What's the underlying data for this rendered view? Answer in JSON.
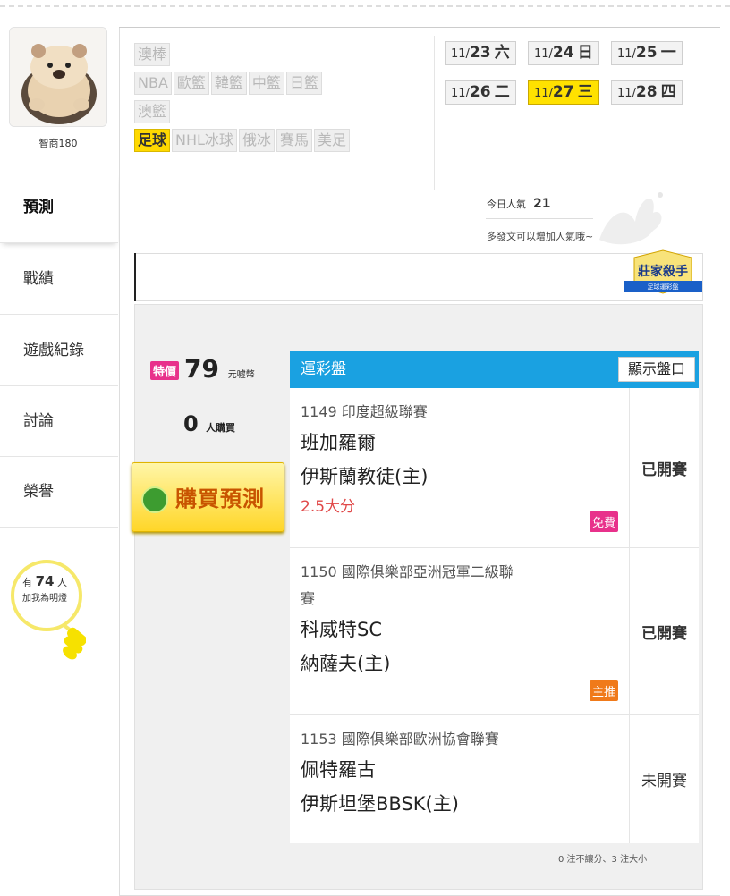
{
  "user": {
    "name": "智商180"
  },
  "nav": [
    "預測",
    "戰績",
    "遊戲紀錄",
    "討論",
    "榮譽"
  ],
  "bulb": {
    "prefix": "有",
    "count": "74",
    "suffix": "人",
    "line2": "加我為明燈"
  },
  "sports": {
    "row1": [
      "澳棒"
    ],
    "row2": [
      "NBA",
      "歐籃",
      "韓籃",
      "中籃",
      "日籃"
    ],
    "row3": [
      "澳籃"
    ],
    "row4": [
      "足球",
      "NHL冰球",
      "俄冰",
      "賽馬",
      "美足"
    ]
  },
  "dates": [
    {
      "m": "11/",
      "d": "23",
      "w": "六"
    },
    {
      "m": "11/",
      "d": "24",
      "w": "日"
    },
    {
      "m": "11/",
      "d": "25",
      "w": "一"
    },
    {
      "m": "11/",
      "d": "26",
      "w": "二"
    },
    {
      "m": "11/",
      "d": "27",
      "w": "三"
    },
    {
      "m": "11/",
      "d": "28",
      "w": "四"
    }
  ],
  "popularity": {
    "label": "今日人氣",
    "value": "21",
    "hint": "多發文可以增加人氣哦~"
  },
  "banner": {
    "logo_title": "莊家殺手",
    "logo_sub": "足球運彩盤"
  },
  "purchase": {
    "sale_label": "特價",
    "price": "79",
    "unit": "元噓幣",
    "buyers": "0",
    "buyers_unit": "人購買",
    "buy_button": "購買預測"
  },
  "table": {
    "title": "運彩盤",
    "show_button": "顯示盤口",
    "rows": [
      {
        "league": "1149 印度超級聯賽",
        "home_away": [
          "班加羅爾",
          "伊斯蘭教徒(主)"
        ],
        "bet": "2.5大分",
        "badge": "免費",
        "status": "已開賽"
      },
      {
        "league": "1150 國際俱樂部亞洲冠軍二級聯",
        "league2": "賽",
        "home_away": [
          "科威特SC",
          "納薩夫(主)"
        ],
        "badge": "主推",
        "status": "已開賽"
      },
      {
        "league": "1153 國際俱樂部歐洲協會聯賽",
        "home_away": [
          "佩特羅古",
          "伊斯坦堡BBSK(主)"
        ],
        "status": "未開賽"
      }
    ]
  },
  "footnote": "0 注不讓分、3 注大小",
  "colors": {
    "accent_yellow": "#ffd900",
    "header_blue": "#1aa1e1",
    "sale_pink": "#e8318b",
    "bet_red": "#e04848",
    "free_badge": "#e8318b",
    "pick_badge": "#f07a1a"
  }
}
